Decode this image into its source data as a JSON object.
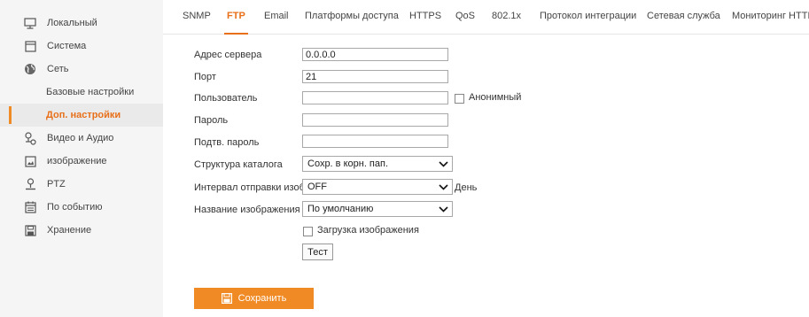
{
  "sidebar": {
    "items": [
      {
        "label": "Локальный",
        "icon": "monitor-icon"
      },
      {
        "label": "Система",
        "icon": "system-icon"
      },
      {
        "label": "Сеть",
        "icon": "globe-icon"
      },
      {
        "label": "Базовые настройки"
      },
      {
        "label": "Доп. настройки",
        "active": true
      },
      {
        "label": "Видео и Аудио",
        "icon": "video-audio-icon"
      },
      {
        "label": "изображение",
        "icon": "image-icon"
      },
      {
        "label": "PTZ",
        "icon": "ptz-icon"
      },
      {
        "label": "По событию",
        "icon": "calendar-icon"
      },
      {
        "label": "Хранение",
        "icon": "storage-icon"
      }
    ]
  },
  "tabs": [
    {
      "label": "SNMP"
    },
    {
      "label": "FTP",
      "active": true
    },
    {
      "label": "Email"
    },
    {
      "label": "Платформы доступа"
    },
    {
      "label": "HTTPS"
    },
    {
      "label": "QoS"
    },
    {
      "label": "802.1x"
    },
    {
      "label": "Протокол интеграции"
    },
    {
      "label": "Сетевая служба"
    },
    {
      "label": "Мониторинг HTTP"
    }
  ],
  "form": {
    "server_address": {
      "label": "Адрес сервера",
      "value": "0.0.0.0"
    },
    "port": {
      "label": "Порт",
      "value": "21"
    },
    "user": {
      "label": "Пользователь",
      "value": "",
      "anonymous_label": "Анонимный"
    },
    "password": {
      "label": "Пароль",
      "value": ""
    },
    "confirm_password": {
      "label": "Подтв. пароль",
      "value": ""
    },
    "directory_structure": {
      "label": "Структура каталога",
      "value": "Сохр. в корн. пап."
    },
    "upload_interval": {
      "label": "Интервал отправки изоб...",
      "value": "OFF",
      "unit": "День"
    },
    "image_name": {
      "label": "Название изображения",
      "value": "По умолчанию"
    },
    "upload_image": {
      "label": "Загрузка изображения"
    },
    "test_label": "Тест"
  },
  "save_label": "Сохранить",
  "colors": {
    "accent": "#f08a24",
    "sidebar_bg": "#f5f5f5"
  }
}
